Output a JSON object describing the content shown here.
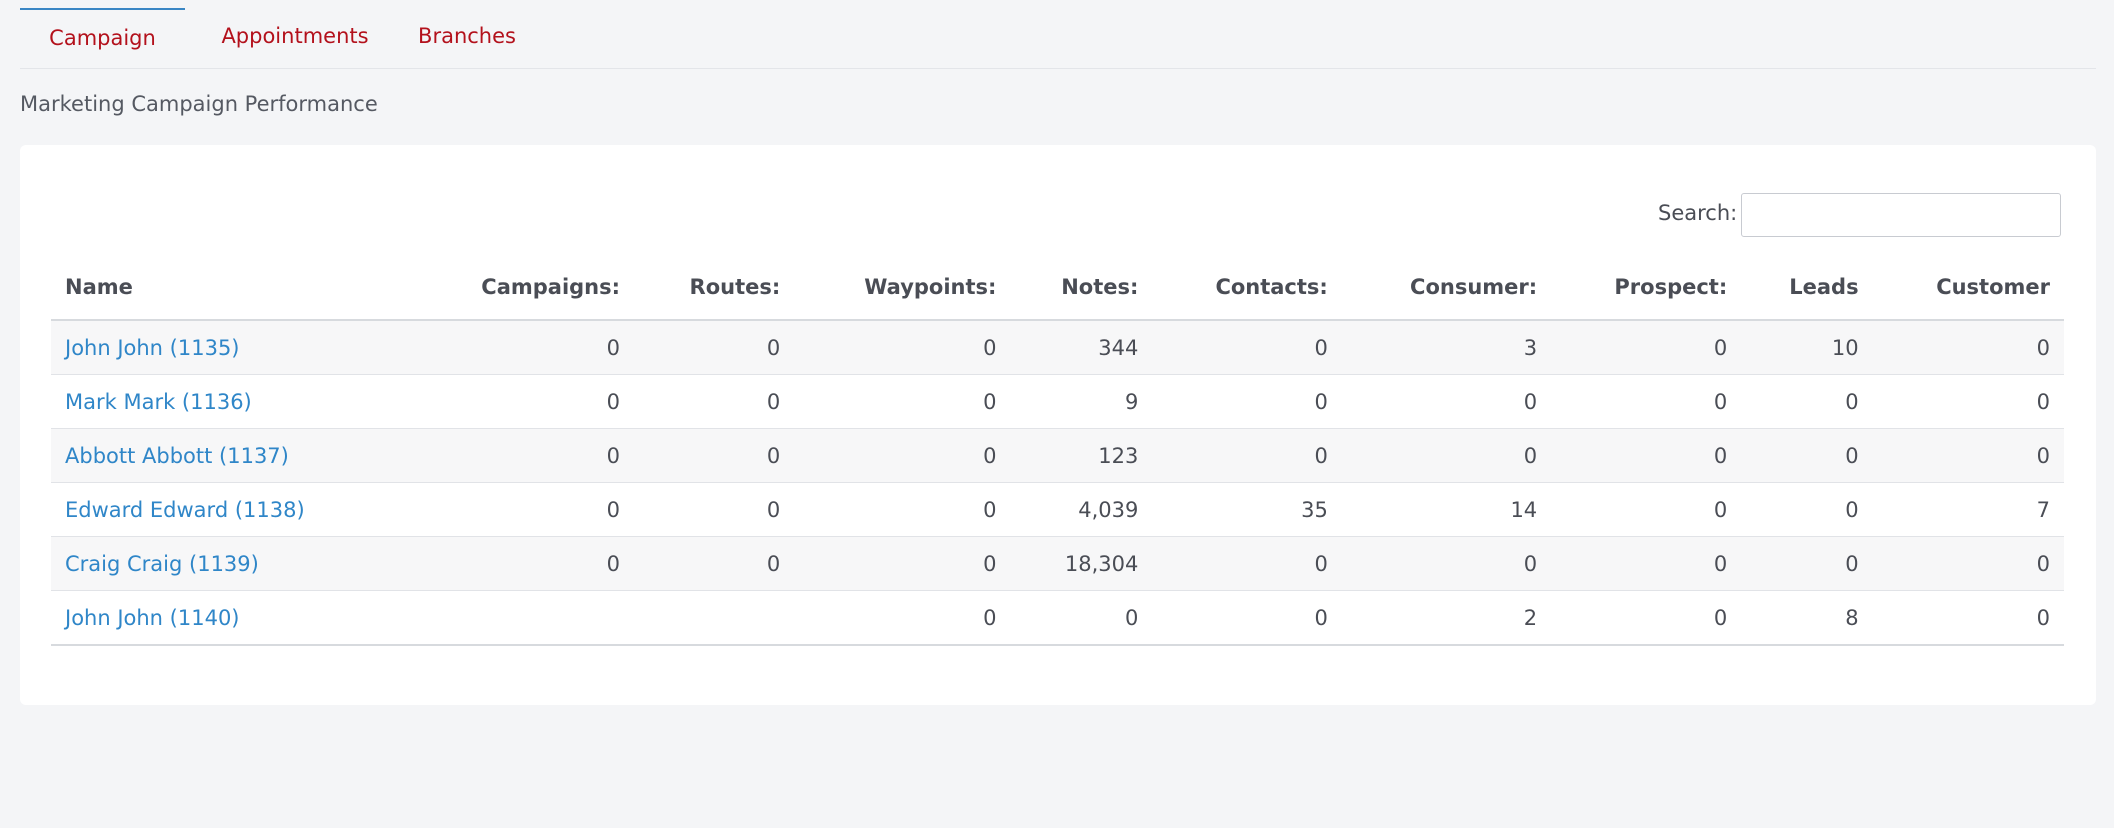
{
  "tabs": [
    {
      "label": "Campaign"
    },
    {
      "label": "Appointments"
    },
    {
      "label": "Branches"
    }
  ],
  "subtitle": "Marketing Campaign Performance",
  "search": {
    "label": "Search:",
    "value": ""
  },
  "columns": [
    "Name",
    "Campaigns:",
    "Routes:",
    "Waypoints:",
    "Notes:",
    "Contacts:",
    "Consumer:",
    "Prospect:",
    "Leads",
    "Customer"
  ],
  "rows": [
    {
      "name": "John John (1135)",
      "campaigns": "0",
      "routes": "0",
      "waypoints": "0",
      "notes": "344",
      "contacts": "0",
      "consumer": "3",
      "prospect": "0",
      "leads": "10",
      "customer": "0"
    },
    {
      "name": "Mark Mark (1136)",
      "campaigns": "0",
      "routes": "0",
      "waypoints": "0",
      "notes": "9",
      "contacts": "0",
      "consumer": "0",
      "prospect": "0",
      "leads": "0",
      "customer": "0"
    },
    {
      "name": "Abbott Abbott (1137)",
      "campaigns": "0",
      "routes": "0",
      "waypoints": "0",
      "notes": "123",
      "contacts": "0",
      "consumer": "0",
      "prospect": "0",
      "leads": "0",
      "customer": "0"
    },
    {
      "name": "Edward Edward (1138)",
      "campaigns": "0",
      "routes": "0",
      "waypoints": "0",
      "notes": "4,039",
      "contacts": "35",
      "consumer": "14",
      "prospect": "0",
      "leads": "0",
      "customer": "7"
    },
    {
      "name": "Craig Craig (1139)",
      "campaigns": "0",
      "routes": "0",
      "waypoints": "0",
      "notes": "18,304",
      "contacts": "0",
      "consumer": "0",
      "prospect": "0",
      "leads": "0",
      "customer": "0"
    },
    {
      "name": "John John (1140)",
      "campaigns": "",
      "routes": "",
      "waypoints": "0",
      "notes": "0",
      "contacts": "0",
      "consumer": "2",
      "prospect": "0",
      "leads": "8",
      "customer": "0"
    }
  ],
  "colors": {
    "tab_text": "#b3111c",
    "active_tab_border": "#3a86c4",
    "link": "#2f86c8",
    "background": "#f4f5f7",
    "panel": "#ffffff"
  }
}
